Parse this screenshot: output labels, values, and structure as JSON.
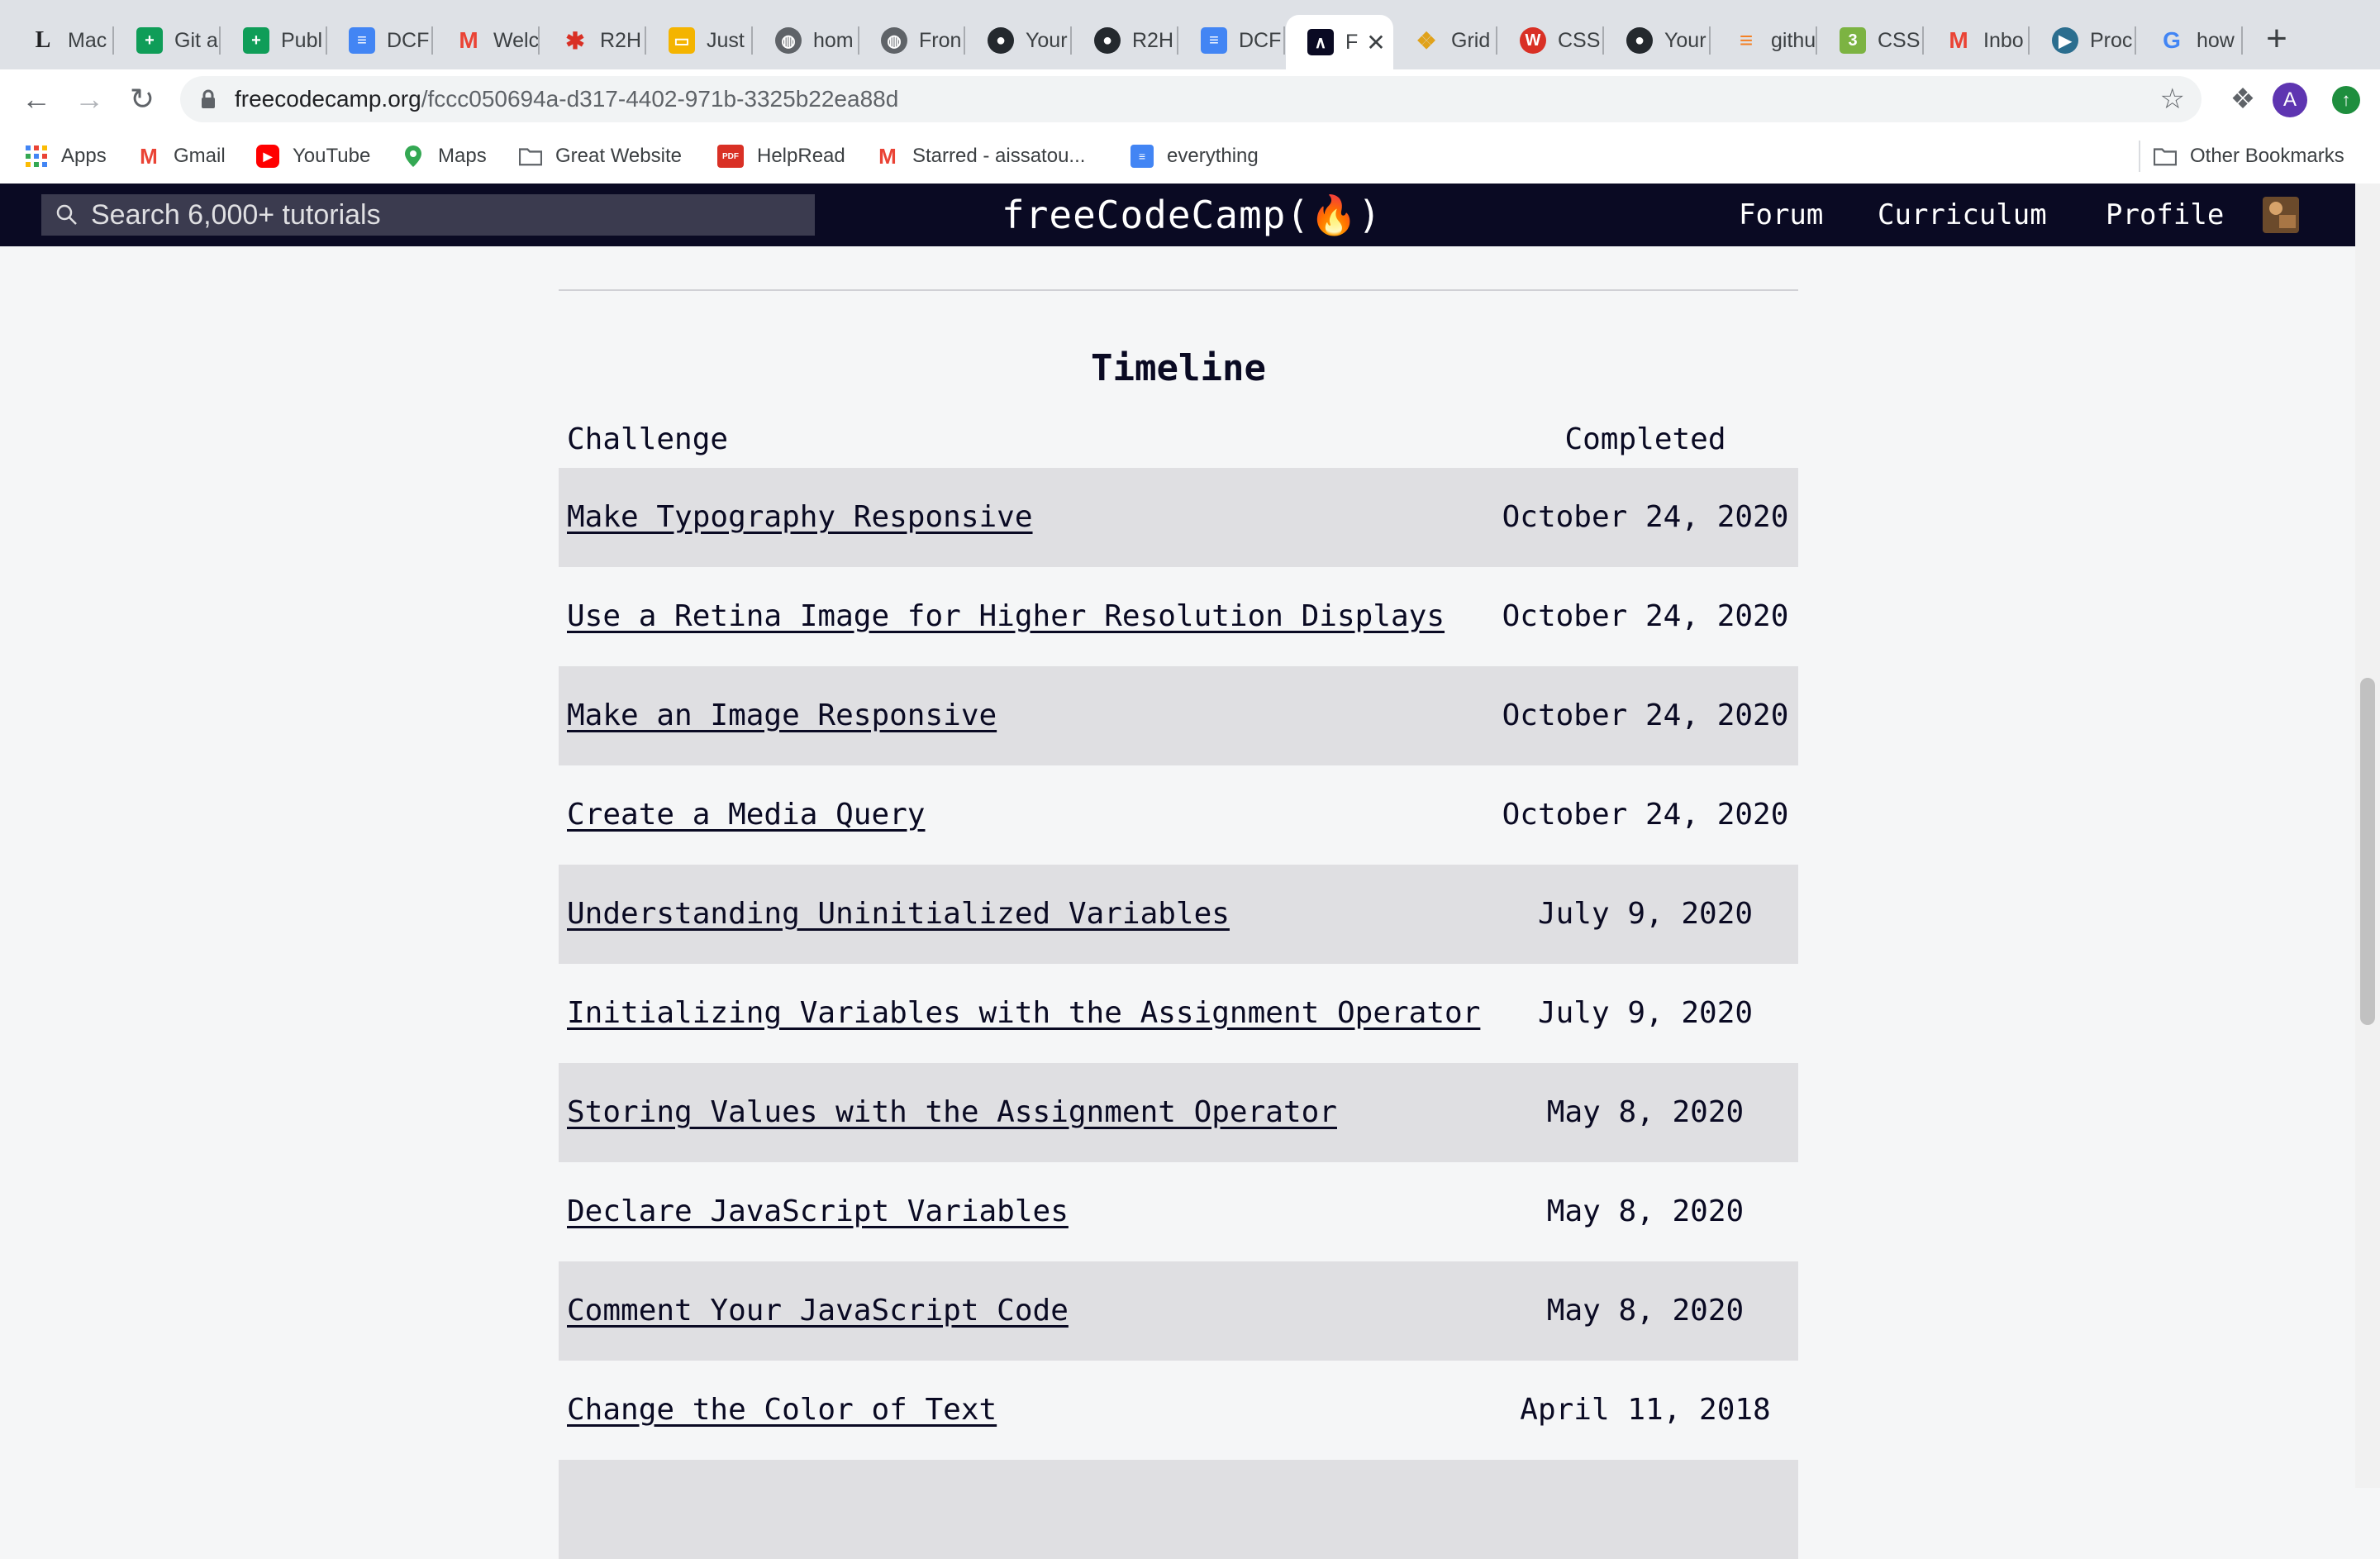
{
  "browser": {
    "tabs": [
      {
        "title": "Mac",
        "icon": "L"
      },
      {
        "title": "Git a",
        "icon": "sheets"
      },
      {
        "title": "Publ",
        "icon": "sheets"
      },
      {
        "title": "DCF",
        "icon": "docs"
      },
      {
        "title": "Welc",
        "icon": "gmail"
      },
      {
        "title": "R2H",
        "icon": "r2h"
      },
      {
        "title": "Just",
        "icon": "slides"
      },
      {
        "title": "hom",
        "icon": "globe"
      },
      {
        "title": "Fron",
        "icon": "globe"
      },
      {
        "title": "Your",
        "icon": "github"
      },
      {
        "title": "R2H",
        "icon": "github"
      },
      {
        "title": "DCF",
        "icon": "docs"
      },
      {
        "title": "F",
        "icon": "fcc",
        "active": true
      },
      {
        "title": "Grid",
        "icon": "medal"
      },
      {
        "title": "CSS",
        "icon": "wordpress"
      },
      {
        "title": "Your",
        "icon": "github"
      },
      {
        "title": "githu",
        "icon": "stackoverflow"
      },
      {
        "title": "CSS",
        "icon": "css3"
      },
      {
        "title": "Inbo",
        "icon": "gmail"
      },
      {
        "title": "Proc",
        "icon": "circle"
      },
      {
        "title": "how",
        "icon": "google"
      }
    ],
    "new_tab_label": "+",
    "url_domain": "freecodecamp.org",
    "url_path": "/fccc050694a-d317-4402-971b-3325b22ea88d",
    "profile_initial": "A",
    "bookmarks": [
      {
        "label": "Apps",
        "icon": "apps-icon"
      },
      {
        "label": "Gmail",
        "icon": "gmail-icon"
      },
      {
        "label": "YouTube",
        "icon": "youtube-icon"
      },
      {
        "label": "Maps",
        "icon": "maps-icon"
      },
      {
        "label": "Great Website",
        "icon": "folder-icon"
      },
      {
        "label": "HelpRead",
        "icon": "pdf-icon"
      },
      {
        "label": "Starred - aissatou...",
        "icon": "gmail-icon"
      },
      {
        "label": "everything",
        "icon": "docs-icon"
      }
    ],
    "other_bookmarks": "Other Bookmarks"
  },
  "fcc": {
    "search_placeholder": "Search 6,000+ tutorials",
    "logo": "freeCodeCamp(🔥)",
    "nav": {
      "forum": "Forum",
      "curriculum": "Curriculum",
      "profile": "Profile"
    }
  },
  "timeline": {
    "title": "Timeline",
    "col_challenge": "Challenge",
    "col_completed": "Completed",
    "rows": [
      {
        "challenge": "Make Typography Responsive",
        "completed": "October 24, 2020"
      },
      {
        "challenge": "Use a Retina Image for Higher Resolution Displays",
        "completed": "October 24, 2020"
      },
      {
        "challenge": "Make an Image Responsive",
        "completed": "October 24, 2020"
      },
      {
        "challenge": "Create a Media Query",
        "completed": "October 24, 2020"
      },
      {
        "challenge": "Understanding Uninitialized Variables",
        "completed": "July 9, 2020"
      },
      {
        "challenge": "Initializing Variables with the Assignment Operator",
        "completed": "July 9, 2020"
      },
      {
        "challenge": "Storing Values with the Assignment Operator",
        "completed": "May 8, 2020"
      },
      {
        "challenge": "Declare JavaScript Variables",
        "completed": "May 8, 2020"
      },
      {
        "challenge": "Comment Your JavaScript Code",
        "completed": "May 8, 2020"
      },
      {
        "challenge": "Change the Color of Text",
        "completed": "April 11, 2018"
      },
      {
        "challenge": "",
        "completed": ""
      }
    ]
  }
}
